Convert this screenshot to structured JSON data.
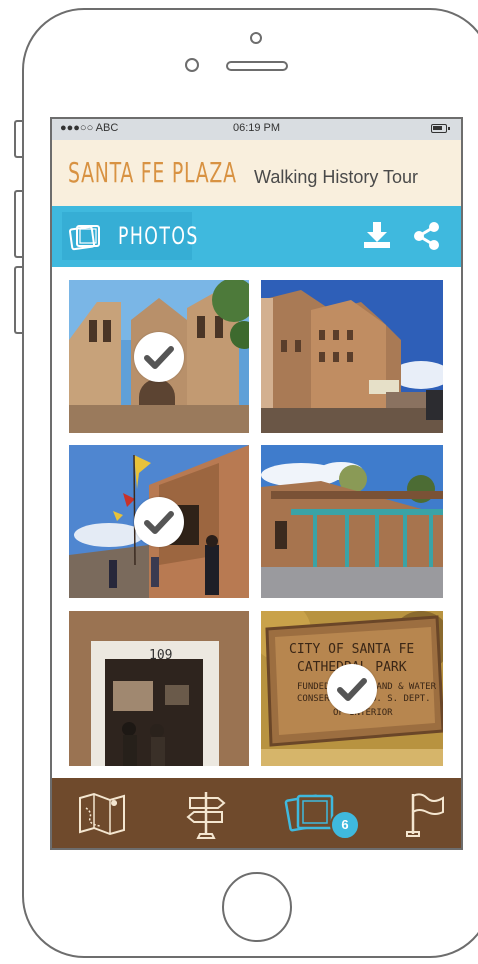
{
  "status_bar": {
    "carrier": "●●●○○ ABC",
    "time": "06:19 PM"
  },
  "app_header": {
    "title": "SANTA FE PLAZA",
    "subtitle": "Walking History Tour"
  },
  "section": {
    "label": "PHOTOS",
    "icon": "photos-icon",
    "actions": [
      "download-icon",
      "share-icon"
    ]
  },
  "photos": [
    {
      "name": "Cathedral Basilica",
      "selected": true
    },
    {
      "name": "La Fonda Hotel",
      "selected": false
    },
    {
      "name": "Plaza Portal with flags",
      "selected": true
    },
    {
      "name": "Palace of the Governors",
      "selected": false
    },
    {
      "name": "Doorway 109",
      "selected": false
    },
    {
      "name": "City of Santa Fe Cathedral Park sign",
      "selected": true
    }
  ],
  "sign_text": {
    "line1": "CITY OF SANTA FE",
    "line2": "CATHEDRAL PARK",
    "line3": "FUNDED BY",
    "line4": "LAND & WATER",
    "line5": "CONSER",
    "line6": "U. S. DEPT.",
    "line7": "OF INTERIOR"
  },
  "door_number": "109",
  "bottom_nav": {
    "items": [
      "map-icon",
      "signpost-icon",
      "photos-icon",
      "flag-icon"
    ],
    "active": "photos-icon",
    "photo_count": "6"
  },
  "colors": {
    "accent_blue": "#3fb9de",
    "header_cream": "#f9efdd",
    "title_orange": "#d89242",
    "nav_brown": "#6f4a2c"
  }
}
